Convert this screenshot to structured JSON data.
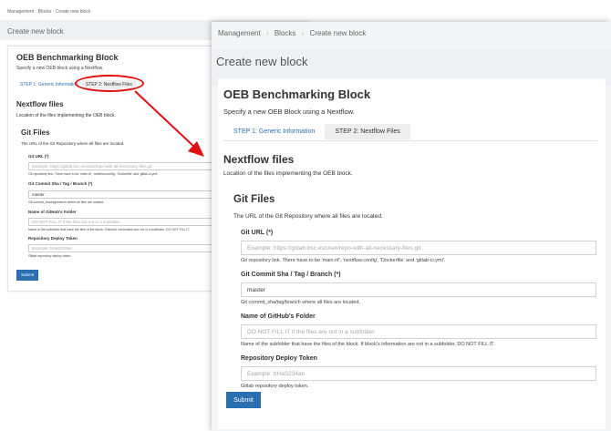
{
  "background_shot": {
    "breadcrumb": "Management  ·  Blocks  ·  Create new block",
    "page_title": "Create new block",
    "card_title": "OEB Benchmarking Block",
    "card_sub": "Specify a new OEB block using a Nextflow.",
    "tab1": "STEP 1: Generic Information",
    "tab2": "STEP 2: Nextflow Files",
    "sec_title": "Nextflow files",
    "sec_sub": "Location of the files implementing the OEB block.",
    "git_title": "Git Files",
    "git_sub": "The URL of the Git Repository where all files are located.",
    "f1_label": "Git URL (*)",
    "f1_placeholder": "Example: https://gitlab.bsc.es/user/repo-with-all-necessary-files.git",
    "f1_help": "Git repository link. There have to be 'main.nf', 'nextflow.config', 'Dockerfile' and 'gitlab-ci.yml'.",
    "f2_label": "Git Commit Sha / Tag / Branch (*)",
    "f2_value": "master",
    "f2_help": "Git commit_sha/tag/branch where all files are located.",
    "f3_label": "Name of GitHub's Folder",
    "f3_placeholder": "DO NOT FILL IT if the files are not in a subfolder.",
    "f3_help": "Name of the subfolder that have the files of the block. If block's information are not in a subfolder, DO NOT FILL IT.",
    "f4_label": "Repository Deploy Token",
    "f4_placeholder": "Example: bHaS234an",
    "f4_help": "Gitlab repository deploy token.",
    "submit": "Submit"
  },
  "breadcrumb": {
    "items": [
      "Management",
      "Blocks",
      "Create new block"
    ],
    "separator": "›"
  },
  "page_title": "Create new block",
  "card": {
    "title": "OEB Benchmarking Block",
    "subtitle": "Specify a new OEB Block using a Nextflow."
  },
  "tabs": [
    {
      "label": "STEP 1: Generic Information",
      "active": false
    },
    {
      "label": "STEP 2: Nextflow Files",
      "active": true
    }
  ],
  "section": {
    "title": "Nextflow files",
    "subtitle": "Location of the files implementing the OEB block."
  },
  "git": {
    "title": "Git Files",
    "subtitle": "The URL of the Git Repository where all files are located.",
    "fields": [
      {
        "label": "Git URL (*)",
        "value": "",
        "placeholder": "Example: https://gitlab.bsc.es/user/repo-with-all-necessary-files.git",
        "help": "Git repository link. There have to be 'main.nf', 'nextflow.config', 'Dockerfile' and 'gitlab-ci.yml'."
      },
      {
        "label": "Git Commit Sha / Tag / Branch (*)",
        "value": "master",
        "placeholder": "",
        "help": "Git commit_sha/tag/branch where all files are located."
      },
      {
        "label": "Name of GitHub's Folder",
        "value": "",
        "placeholder": "DO NOT FILL IT if the files are not in a subfolder.",
        "help": "Name of the subfolder that have the files of the block. If block's information are not in a subfolder, DO NOT FILL IT."
      },
      {
        "label": "Repository Deploy Token",
        "value": "",
        "placeholder": "Example: bHaS234an",
        "help": "Gitlab repository deploy token."
      }
    ]
  },
  "submit_label": "Submit",
  "colors": {
    "accent": "#2a6fb0",
    "highlight": "#e01010",
    "page_bg": "#f4f5f7"
  }
}
